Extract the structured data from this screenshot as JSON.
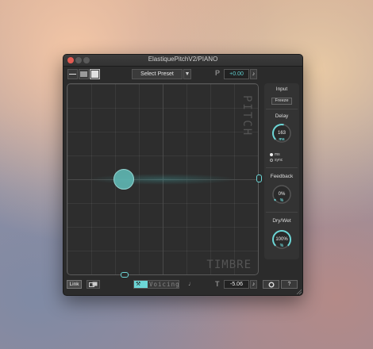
{
  "window": {
    "title": "ElastiquePitchV2/PIANO"
  },
  "toolbar": {
    "preset_label": "Select Preset",
    "preset_arrow": "▼",
    "pitch_icon": "P",
    "pitch_value": "+0.00",
    "note_glyph": "♪"
  },
  "pad": {
    "pitch_axis_label": "PITCH",
    "timbre_axis_label": "TIMBRE"
  },
  "panel": {
    "input_title": "Input",
    "freeze_label": "Freeze",
    "delay_title": "Delay",
    "delay_value": "163",
    "delay_unit": "ms",
    "delay_level": 0.55,
    "delay_mode_options": [
      "ms",
      "sync"
    ],
    "delay_mode_selected": "ms",
    "feedback_title": "Feedback",
    "feedback_value": "0%",
    "feedback_unit": "%",
    "feedback_level": 0.0,
    "drywet_title": "Dry/Wet",
    "drywet_value": "100%",
    "drywet_unit": "%",
    "drywet_level": 1.0
  },
  "bottom": {
    "link_label": "Link",
    "voicing_label": "Voicing",
    "voicing_icon": "⚒",
    "voicing_end_glyph": "♩",
    "timbre_icon": "T",
    "timbre_value": "-5.06",
    "note_glyph": "♪",
    "help_label": "?"
  },
  "colors": {
    "accent": "#6cd6d6",
    "background": "#2b2b2b"
  }
}
